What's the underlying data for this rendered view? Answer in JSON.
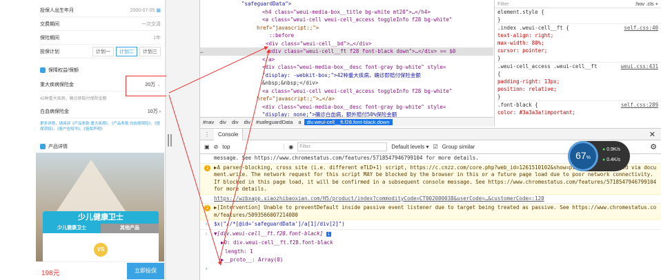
{
  "mobile": {
    "rows": [
      {
        "label": "投保人出生年月",
        "value": "2000-07-05"
      },
      {
        "label": "交费期间",
        "value": "一次交清"
      },
      {
        "label": "保险期间",
        "value": "1年"
      }
    ],
    "plan": {
      "label": "投保计划",
      "options": [
        "计划一",
        "计划二",
        "计划三"
      ]
    },
    "section1": "保障权益/保额",
    "sum": {
      "label": "重大疾病保险金",
      "value": "20万"
    },
    "sum_note": "42种重大疾病，确诊即赔付保险金额",
    "accident": {
      "label": "白血病保险金",
      "value": "10万"
    },
    "notice": "更多详情，请阅读《产品条款-重大疾病》、《产品条款-白血病保险》、《投保须知》、《客户告知书》、《投保声明》",
    "section2": "产品详情",
    "card": {
      "title": "少儿健康卫士",
      "tab1": "少儿健康卫士",
      "tab2": "其他产品",
      "vs": "VS"
    },
    "price": "198元",
    "buy": "立即投保"
  },
  "elements": {
    "lines": [
      "\"safeguardData\">",
      "<h4 class=\"weui-media-box__title  bg-white mt20\">…</h4>",
      "<a class=\"weui-cell weui-cell_access toggleInfo f28 bg-white\"",
      "href=\"javascript:;\">",
      "::before",
      "<div class=\"weui-cell__bd\">…</div>",
      "<div class=\"weui-cell__ft f28 font-black down\">…</div> == $0",
      "</a>",
      "<div class=\"weui-media-box__desc font-gray bg-white\" style=",
      "\"display: -webkit-box;\">42种重大疾病，确诊即赔付保险金额",
      "&nbsp;&nbsp;</div>",
      "<a class=\"weui-cell weui-cell_access toggleInfo f28 bg-white\"",
      "href=\"javascript:;\">…</a>",
      "<div class=\"weui-media-box__desc font-gray bg-white\" style=",
      "\"display: none;\">确诊白血病，额外赔付50%保险金额"
    ],
    "crumbs": [
      "#nav",
      "div",
      "div",
      "div",
      "#safeguardData",
      "a",
      "div.weui-cell__ft.f28.font-black.down"
    ]
  },
  "styles": {
    "tabs": [
      ":hov",
      ".cls",
      "+"
    ],
    "filter": "Filter",
    "lines": [
      {
        "text": "element.style {",
        "link": ""
      },
      {
        "text": "}",
        "link": ""
      },
      {
        "text": ".index .weui-cell__ft {",
        "link": "self.css:40"
      },
      {
        "text": "  text-align: right;",
        "link": ""
      },
      {
        "text": "  max-width: 80%;",
        "link": ""
      },
      {
        "text": "  cursor: pointer;",
        "link": ""
      },
      {
        "text": "}",
        "link": ""
      },
      {
        "text": ".weui-cell_access .weui-cell__ft",
        "link": "weui.css:431"
      },
      {
        "text": "{",
        "link": ""
      },
      {
        "text": "  padding-right: 13px;",
        "link": ""
      },
      {
        "text": "  position: relative;",
        "link": ""
      },
      {
        "text": "}",
        "link": ""
      },
      {
        "text": ".font-black {",
        "link": "self.css:289"
      },
      {
        "text": "  color: #3a3a3a!important;",
        "link": ""
      }
    ]
  },
  "console": {
    "tab": "Console",
    "context": "top",
    "filter_placeholder": "Filter",
    "levels": "Default levels",
    "group_similar": "Group similar",
    "messages": [
      {
        "type": "log",
        "text": "message. See https://www.chromestatus.com/features/5718547946799104 for more details."
      },
      {
        "type": "warn",
        "count": "2",
        "text": "▶A parser-blocking, cross site (i.e. different eTLD+1) script, https://c.cnzz.com/core.php?web_id=1261510102&show=pic&t=z, is invoked via document.write. The network request for this script MAY be blocked by the browser in this or a future page load due to poor network connectivity. If blocked in this page load, it will be confirmed in a subsequent console message. See https://www.chromestatus.com/features/5718547946799104 for more details."
      },
      {
        "type": "log",
        "text": "https://wzbxapp.xiaozhibaoxian.com/H5/product/index?commodityCode=CT002000038&userCode=…&customerCode=:120"
      },
      {
        "type": "warn",
        "count": "2",
        "text": "▶[Intervention] Unable to preventDefault inside passive event listener due to target being treated as passive. See https://www.chromestatus.com/features/5093566007214080"
      }
    ],
    "input": "$x(\"//*[@id='safeguardData']/a[1]/div[2]\")",
    "result": "▼[div.weui-cell__ft.f28.font-black]",
    "item": "▶0: div.weui-cell__ft.f28.font-black",
    "length": "length: 1",
    "proto": "▶__proto__: Array(0)"
  },
  "gauge": {
    "percent": "67",
    "unit": "%",
    "up": "0.9K/s",
    "down": "0.4K/s"
  }
}
